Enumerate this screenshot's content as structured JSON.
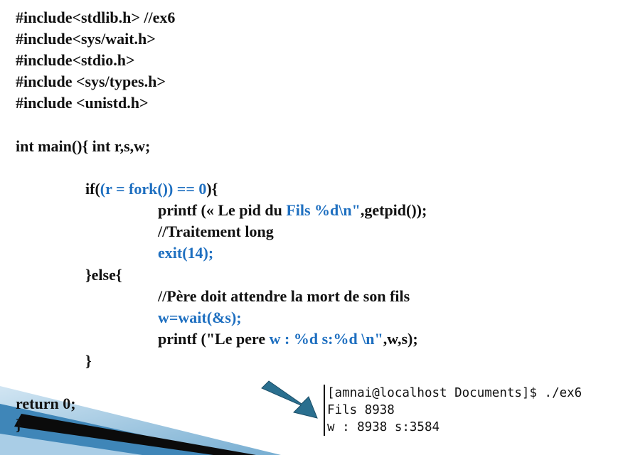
{
  "code": {
    "l1": "#include<stdlib.h> //ex6",
    "l2": "#include<sys/wait.h>",
    "l3": "#include<stdio.h>",
    "l4": "#include <sys/types.h>",
    "l5": "#include <unistd.h>",
    "main": "int main(){ int r,s,w;",
    "if_a": "if(",
    "if_b": "(r = fork()) == 0",
    "if_c": "){",
    "printf1_a": "printf (« Le pid du ",
    "printf1_b": "Fils %d\\n\"",
    "printf1_c": ",getpid());",
    "comment1": "//Traitement long",
    "exit": "exit(14);",
    "else": "}else{",
    "comment2": "//Père doit attendre la mort de son fils",
    "wait": "w=wait(&s);",
    "printf2_a": "printf (\"Le pere ",
    "printf2_b": "w : %d s:%d \\n\"",
    "printf2_c": ",w,s);",
    "close_if": "}",
    "return": "return 0;",
    "close_main": "}"
  },
  "terminal": {
    "line1": "[amnai@localhost Documents]$ ./ex6",
    "line2": "Fils 8938",
    "line3": "w : 8938 s:3584"
  },
  "colors": {
    "keyword_blue": "#1e6fc0",
    "arrow": "#2a6f8f",
    "accent": "#1e5f8a"
  },
  "icons": {
    "arrow": "arrow-down-right-icon"
  }
}
